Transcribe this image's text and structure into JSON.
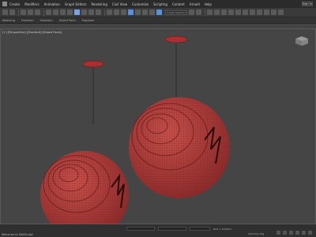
{
  "menubar": {
    "items": [
      "Create",
      "Modifiers",
      "Animation",
      "Graph Editors",
      "Rendering",
      "Civil View",
      "Customize",
      "Scripting",
      "Content",
      "Arnold",
      "Help"
    ],
    "signin_label": "Sign In"
  },
  "toolbar": {
    "selection_set_placeholder": "Create Selection Se"
  },
  "ribbon": {
    "items": [
      "Modeling",
      "Freeform",
      "Selection",
      "Object Paint",
      "Populate"
    ],
    "right_label": ""
  },
  "viewport": {
    "label": "[+] [Perspective] [Standard] [Edged Faces]",
    "object_color": "#b23a3a",
    "wire_color": "#6a1818"
  },
  "statusbar": {
    "left_text": "Welcome to MAXScript.",
    "coords_text": "Grid = 10.0mm",
    "coords2_text": "Add Time Tag"
  },
  "colors": {
    "background": "#454545",
    "accent": "#5b8fd6"
  }
}
